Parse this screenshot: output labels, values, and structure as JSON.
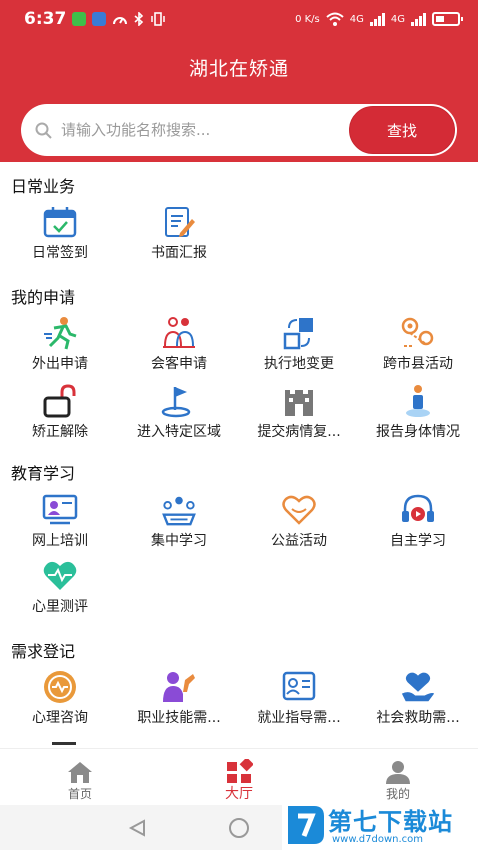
{
  "status_bar": {
    "time": "6:37",
    "speed": "0 K/s",
    "net1": "4G",
    "net2": "4G"
  },
  "app": {
    "title": "湖北在矫通"
  },
  "search": {
    "placeholder": "请输入功能名称搜索...",
    "button_label": "查找"
  },
  "sections": {
    "daily": {
      "title": "日常业务",
      "items": [
        {
          "label": "日常签到",
          "icon": "calendar-check-icon"
        },
        {
          "label": "书面汇报",
          "icon": "written-report-icon"
        }
      ]
    },
    "apply": {
      "title": "我的申请",
      "items": [
        {
          "label": "外出申请",
          "icon": "running-person-icon"
        },
        {
          "label": "会客申请",
          "icon": "meeting-guests-icon"
        },
        {
          "label": "执行地变更",
          "icon": "location-change-icon"
        },
        {
          "label": "跨市县活动",
          "icon": "cross-region-icon"
        },
        {
          "label": "矫正解除",
          "icon": "unlock-icon"
        },
        {
          "label": "进入特定区域",
          "icon": "flag-zone-icon"
        },
        {
          "label": "提交病情复...",
          "icon": "castle-icon"
        },
        {
          "label": "报告身体情况",
          "icon": "person-status-icon"
        }
      ]
    },
    "education": {
      "title": "教育学习",
      "items": [
        {
          "label": "网上培训",
          "icon": "online-training-icon"
        },
        {
          "label": "集中学习",
          "icon": "group-study-icon"
        },
        {
          "label": "公益活动",
          "icon": "heart-hands-icon"
        },
        {
          "label": "自主学习",
          "icon": "headphones-icon"
        },
        {
          "label": "心里测评",
          "icon": "heart-pulse-icon"
        }
      ]
    },
    "needs": {
      "title": "需求登记",
      "items": [
        {
          "label": "心理咨询",
          "icon": "psych-consult-icon"
        },
        {
          "label": "职业技能需...",
          "icon": "vocational-skill-icon"
        },
        {
          "label": "就业指导需...",
          "icon": "employment-guide-icon"
        },
        {
          "label": "社会救助需...",
          "icon": "social-aid-icon"
        }
      ]
    }
  },
  "tabs": [
    {
      "label": "首页",
      "icon": "home-icon"
    },
    {
      "label": "大厅",
      "icon": "hall-icon"
    },
    {
      "label": "我的",
      "icon": "person-icon"
    }
  ],
  "watermark": {
    "name": "第七下载站",
    "url": "www.d7down.com"
  },
  "colors": {
    "brand": "#d8323a",
    "icon_blue": "#2e74c9",
    "icon_orange": "#e98b3e",
    "icon_green": "#2bb86a",
    "icon_purple": "#8a4bd6",
    "watermark": "#1b8ad8"
  }
}
